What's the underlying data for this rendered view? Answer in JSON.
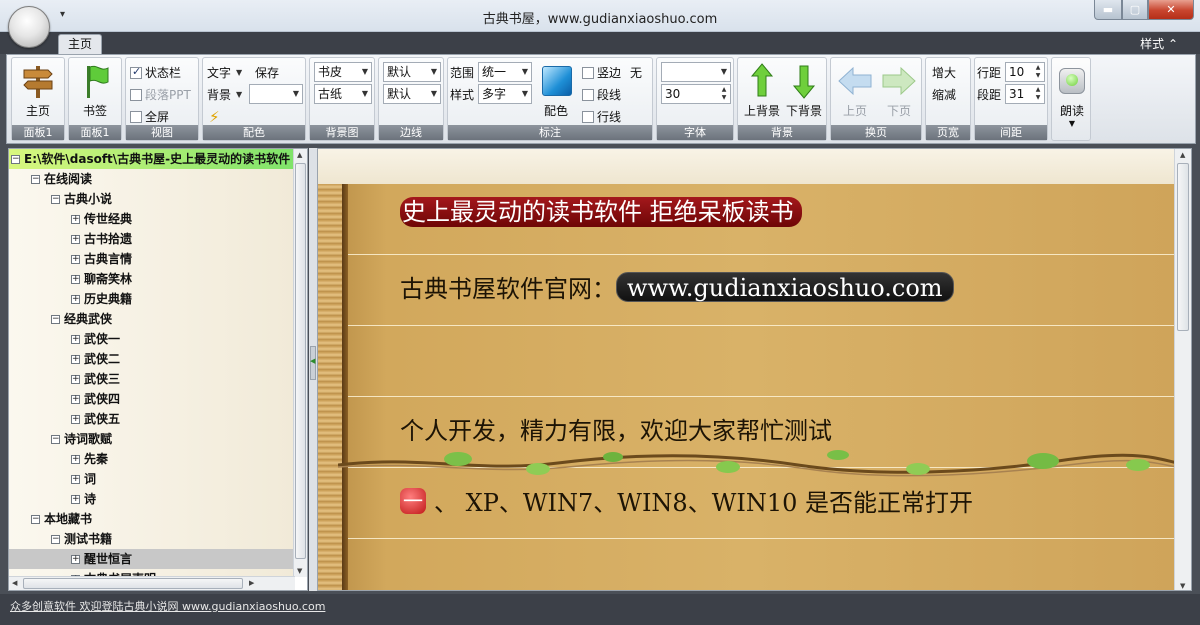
{
  "window": {
    "title": "古典书屋，www.gudianxiaoshuo.com",
    "qat_arrow": "▾",
    "min_glyph": "▬",
    "max_glyph": "▢",
    "close_glyph": "✕"
  },
  "ribbon": {
    "tab_home": "主页",
    "style_menu": "样式 ⌃",
    "groups": {
      "panel1a": {
        "label": "面板1",
        "button": "主页"
      },
      "panel1b": {
        "label": "面板1",
        "button": "书签"
      },
      "view": {
        "label": "视图",
        "status_bar": "状态栏",
        "para_ppt": "段落PPT",
        "fullscreen": "全屏",
        "status_bar_checked": true,
        "para_ppt_checked": false,
        "fullscreen_checked": false
      },
      "color": {
        "label": "配色",
        "text": "文字",
        "save": "保存",
        "background": "背景"
      },
      "bg_image": {
        "label": "背景图",
        "cover": "书皮",
        "paper": "古纸"
      },
      "border": {
        "label": "边线",
        "top": "默认",
        "bottom": "默认"
      },
      "annotation": {
        "label": "标注",
        "range_label": "范围",
        "range_value": "统一",
        "style_label": "样式",
        "style_value": "多字",
        "color_button": "配色",
        "vertical_edge": "竖边",
        "none": "无",
        "para_line": "段线",
        "row_line": "行线"
      },
      "font": {
        "label": "字体",
        "name": "",
        "size": "30"
      },
      "background": {
        "label": "背景",
        "prev": "上背景",
        "next": "下背景"
      },
      "paging": {
        "label": "换页",
        "prev": "上页",
        "next": "下页"
      },
      "page_width": {
        "label": "页宽",
        "increase": "增大",
        "decrease": "缩减"
      },
      "spacing": {
        "label": "间距",
        "line_label": "行距",
        "line_value": "10",
        "para_label": "段距",
        "para_value": "31"
      },
      "read": {
        "label": "朗读"
      }
    }
  },
  "tree": {
    "root": "E:\\软件\\dasoft\\古典书屋-史上最灵动的读书软件",
    "nodes": [
      {
        "text": "在线阅读",
        "level": 1
      },
      {
        "text": "古典小说",
        "level": 2
      },
      {
        "text": "传世经典",
        "level": 3
      },
      {
        "text": "古书拾遗",
        "level": 3
      },
      {
        "text": "古典言情",
        "level": 3
      },
      {
        "text": "聊斋笑林",
        "level": 3
      },
      {
        "text": "历史典籍",
        "level": 3
      },
      {
        "text": "经典武侠",
        "level": 2
      },
      {
        "text": "武侠一",
        "level": 3
      },
      {
        "text": "武侠二",
        "level": 3
      },
      {
        "text": "武侠三",
        "level": 3
      },
      {
        "text": "武侠四",
        "level": 3
      },
      {
        "text": "武侠五",
        "level": 3
      },
      {
        "text": "诗词歌赋",
        "level": 2
      },
      {
        "text": "先秦",
        "level": 3
      },
      {
        "text": "词",
        "level": 3
      },
      {
        "text": "诗",
        "level": 3
      },
      {
        "text": "本地藏书",
        "level": 1
      },
      {
        "text": "测试书籍",
        "level": 2
      },
      {
        "text": "醒世恒言",
        "level": 3,
        "selected": true
      },
      {
        "text": "古典书屋声明",
        "level": 3
      }
    ]
  },
  "reader": {
    "line1": "史上最灵动的读书软件  拒绝呆板读书",
    "line2_prefix": "古典书屋软件官网：",
    "line2_url": "www.gudianxiaoshuo.com",
    "line3": "个人开发，精力有限，欢迎大家帮忙测试",
    "line4_badge": "一",
    "line4_text": "、 XP、WIN7、WIN8、WIN10 是否能正常打开"
  },
  "status": {
    "text": "众多创意软件 欢迎登陆古典小说网  www.gudianxiaoshuo.com"
  }
}
